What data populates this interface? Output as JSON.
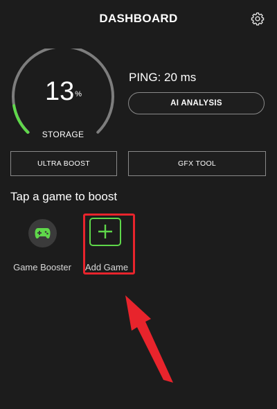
{
  "header": {
    "title": "DASHBOARD",
    "settings_icon": "gear-icon"
  },
  "storage_gauge": {
    "value": "13",
    "unit": "%",
    "label": "STORAGE",
    "fill_percent": 13,
    "track_color": "#7d7d7d",
    "fill_color": "#5fd84a"
  },
  "ping": {
    "text": "PING: 20 ms"
  },
  "buttons": {
    "ai_analysis": "AI ANALYSIS",
    "ultra_boost": "ULTRA BOOST",
    "gfx_tool": "GFX TOOL"
  },
  "games_section": {
    "heading": "Tap a game to boost",
    "tiles": [
      {
        "label": "Game Booster",
        "icon": "gamepad-icon"
      },
      {
        "label": "Add Game",
        "icon": "plus-icon"
      }
    ]
  },
  "annotation": {
    "highlight_color": "#e8242c"
  },
  "colors": {
    "background": "#1c1c1c",
    "accent": "#5fd84a"
  }
}
